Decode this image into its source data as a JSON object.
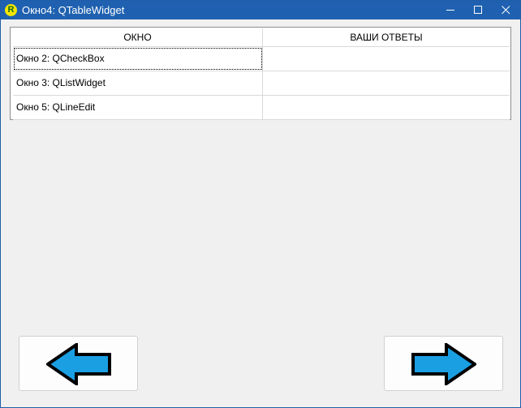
{
  "window": {
    "title": "Окно4: QTableWidget",
    "icons": {
      "app": "r-logo-icon",
      "minimize": "minimize-icon",
      "maximize": "maximize-icon",
      "close": "close-icon"
    }
  },
  "table": {
    "headers": [
      "ОКНО",
      "ВАШИ ОТВЕТЫ"
    ],
    "rows": [
      {
        "window": "Окно 2: QCheckBox",
        "answer": ""
      },
      {
        "window": "Окно 3: QListWidget",
        "answer": ""
      },
      {
        "window": "Окно 5: QLineEdit",
        "answer": ""
      }
    ],
    "focused_row": 0
  },
  "navigation": {
    "back_icon": "left-arrow-icon",
    "forward_icon": "right-arrow-icon",
    "arrow_color": "#1a9fe3"
  },
  "colors": {
    "titlebar": "#1f61b0",
    "background": "#f0f0f0"
  }
}
